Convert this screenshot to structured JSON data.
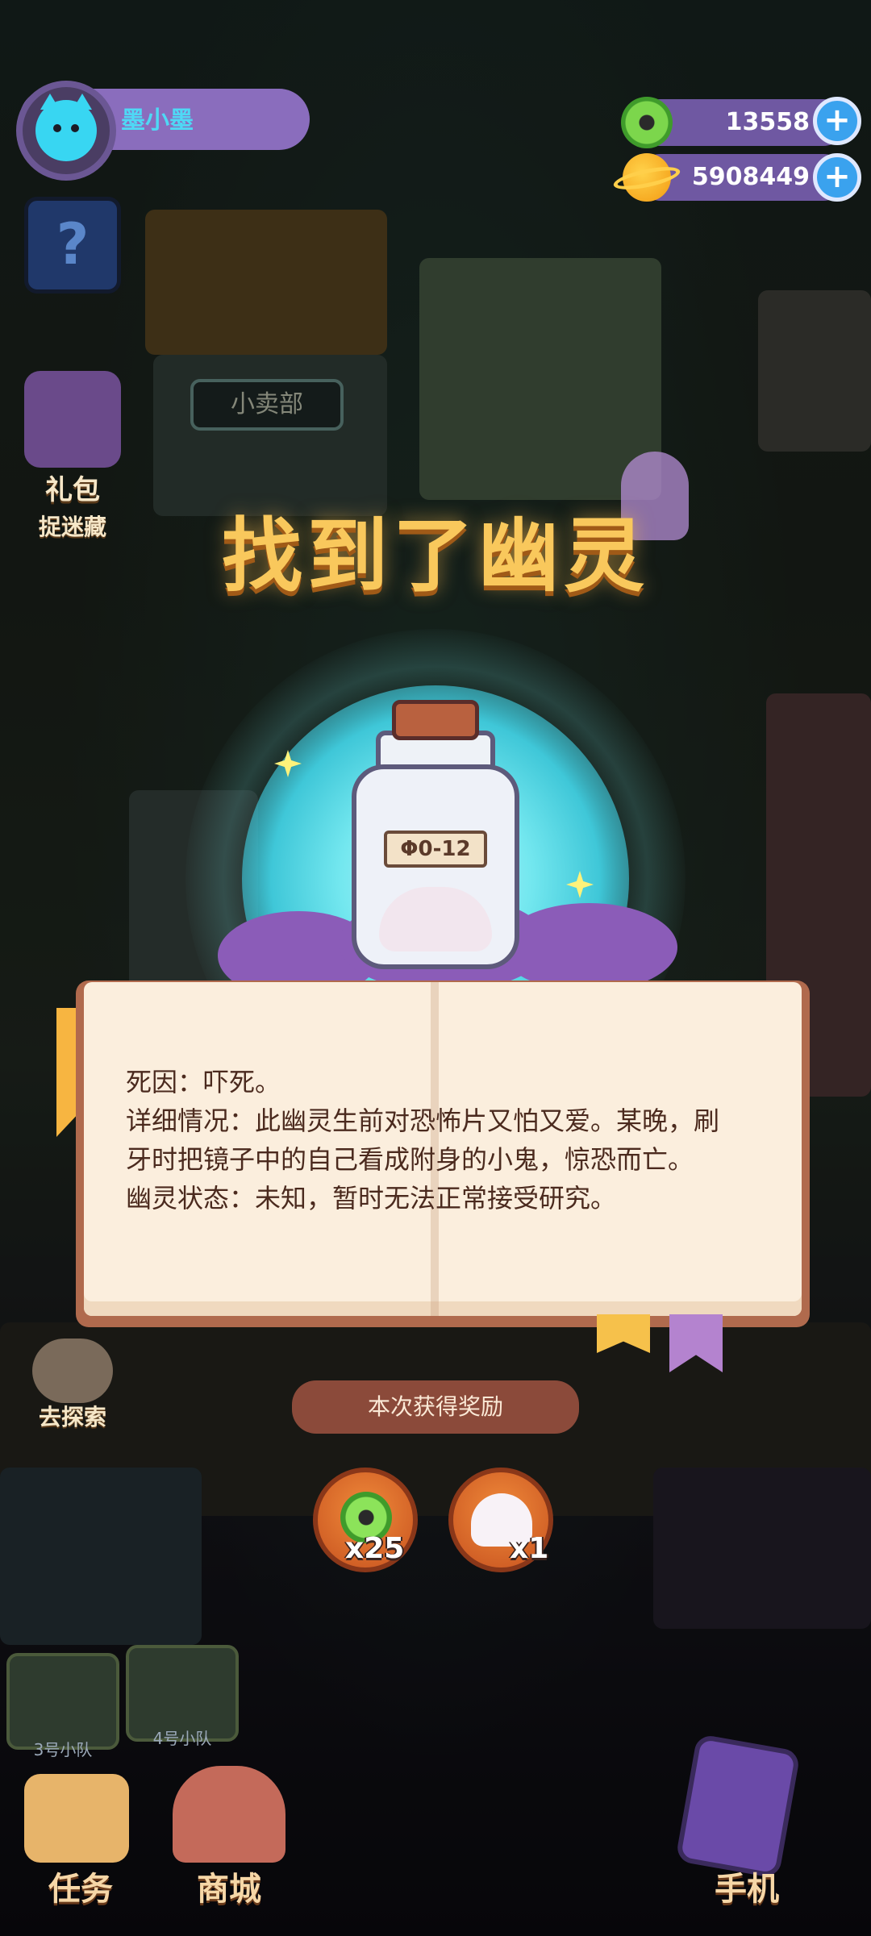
{
  "player": {
    "name": "墨小墨"
  },
  "currencies": {
    "donuts": "13558",
    "coins": "5908449"
  },
  "left_menu": {
    "gift_label_1": "礼包",
    "gift_label_2": "捉迷藏",
    "explore_label": "去探索"
  },
  "popup": {
    "title": "找到了幽灵",
    "jar_label": "Φ0-12",
    "description_lines": [
      "死因：吓死。",
      "详细情况：此幽灵生前对恐怖片又怕又爱。某晚，刷",
      "牙时把镜子中的自己看成附身的小鬼，惊恐而亡。",
      "幽灵状态：未知，暂时无法正常接受研究。"
    ],
    "reward_title": "本次获得奖励",
    "rewards": [
      {
        "icon": "donut-icon",
        "count": "x25"
      },
      {
        "icon": "ghost-icon",
        "count": "x1"
      }
    ]
  },
  "scene": {
    "shop_sign": "小卖部",
    "team_3": "3号小队",
    "team_4": "4号小队"
  },
  "bottom_nav": {
    "task": "任务",
    "shop": "商城",
    "phone": "手机"
  },
  "colors": {
    "title": "#f9c85c",
    "book_text": "#4b2a1e",
    "accent_blue": "#3aa2ee",
    "purple_bar": "#6f58a2"
  }
}
